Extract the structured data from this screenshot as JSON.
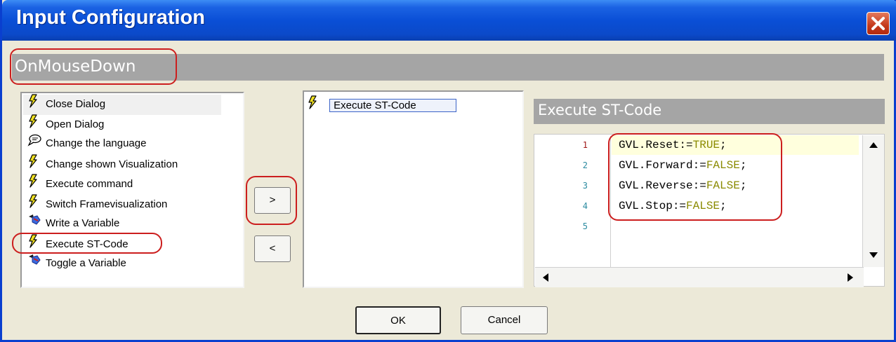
{
  "window": {
    "title": "Input Configuration"
  },
  "event": {
    "name": "OnMouseDown"
  },
  "actions": [
    {
      "label": "Close Dialog",
      "icon": "lightning-icon"
    },
    {
      "label": "Open Dialog",
      "icon": "lightning-icon"
    },
    {
      "label": "Change the language",
      "icon": "speech-bubble-icon"
    },
    {
      "label": "Change shown Visualization",
      "icon": "lightning-icon"
    },
    {
      "label": "Execute command",
      "icon": "lightning-icon"
    },
    {
      "label": "Switch Framevisualization",
      "icon": "lightning-icon"
    },
    {
      "label": "Write a Variable",
      "icon": "write-variable-icon"
    },
    {
      "label": "Execute ST-Code",
      "icon": "lightning-icon"
    },
    {
      "label": "Toggle a Variable",
      "icon": "write-variable-icon"
    }
  ],
  "transfer": {
    "add_label": ">",
    "remove_label": "<"
  },
  "selected_actions": [
    {
      "label": "Execute ST-Code",
      "icon": "lightning-icon"
    }
  ],
  "editor": {
    "title": "Execute ST-Code",
    "lines": [
      {
        "num": "1",
        "var": "GVL.Reset",
        "op": ":=",
        "value": "TRUE",
        "end": ";"
      },
      {
        "num": "2",
        "var": "GVL.Forward",
        "op": ":=",
        "value": "FALSE",
        "end": ";"
      },
      {
        "num": "3",
        "var": "GVL.Reverse",
        "op": ":=",
        "value": "FALSE",
        "end": ";"
      },
      {
        "num": "4",
        "var": "GVL.Stop",
        "op": ":=",
        "value": "FALSE",
        "end": ";"
      },
      {
        "num": "5",
        "var": "",
        "op": "",
        "value": "",
        "end": ""
      }
    ]
  },
  "buttons": {
    "ok": "OK",
    "cancel": "Cancel"
  },
  "colors": {
    "titlebar": "#0a4fd6",
    "highlight": "#cc1e1e",
    "section_bar": "#a5a5a5",
    "value_literal": "#8a8a00",
    "line_number": "#2a8aa0"
  }
}
